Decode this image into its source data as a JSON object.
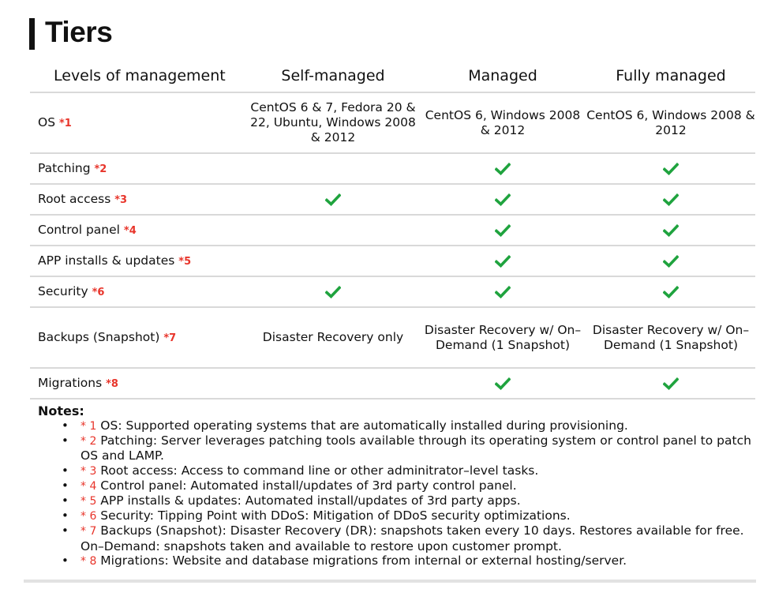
{
  "page": {
    "title": "Tiers"
  },
  "colors": {
    "accent_red": "#e8352b",
    "check_green": "#1fa33e",
    "divider": "#d9d9d9"
  },
  "table": {
    "headers": [
      "Levels of management",
      "Self-managed",
      "Managed",
      "Fully managed"
    ],
    "rows": [
      {
        "feature": "OS",
        "ref": "*1",
        "height": "tall",
        "cells": [
          {
            "type": "text",
            "value": "CentOS 6 & 7, Fedora 20 & 22, Ubuntu, Windows 2008 & 2012"
          },
          {
            "type": "text",
            "value": "CentOS 6, Windows 2008 & 2012"
          },
          {
            "type": "text",
            "value": "CentOS 6, Windows 2008 & 2012"
          }
        ]
      },
      {
        "feature": "Patching",
        "ref": "*2",
        "height": "short",
        "cells": [
          {
            "type": "empty",
            "value": ""
          },
          {
            "type": "check",
            "value": "check-icon"
          },
          {
            "type": "check",
            "value": "check-icon"
          }
        ]
      },
      {
        "feature": "Root access",
        "ref": "*3",
        "height": "short",
        "cells": [
          {
            "type": "check",
            "value": "check-icon"
          },
          {
            "type": "check",
            "value": "check-icon"
          },
          {
            "type": "check",
            "value": "check-icon"
          }
        ]
      },
      {
        "feature": "Control panel",
        "ref": "*4",
        "height": "short",
        "cells": [
          {
            "type": "empty",
            "value": ""
          },
          {
            "type": "check",
            "value": "check-icon"
          },
          {
            "type": "check",
            "value": "check-icon"
          }
        ]
      },
      {
        "feature": "APP installs & updates",
        "ref": "*5",
        "height": "short",
        "cells": [
          {
            "type": "empty",
            "value": ""
          },
          {
            "type": "check",
            "value": "check-icon"
          },
          {
            "type": "check",
            "value": "check-icon"
          }
        ]
      },
      {
        "feature": "Security",
        "ref": "*6",
        "height": "short",
        "cells": [
          {
            "type": "check",
            "value": "check-icon"
          },
          {
            "type": "check",
            "value": "check-icon"
          },
          {
            "type": "check",
            "value": "check-icon"
          }
        ]
      },
      {
        "feature": "Backups (Snapshot)",
        "ref": "*7",
        "height": "tall",
        "cells": [
          {
            "type": "text",
            "value": "Disaster Recovery only"
          },
          {
            "type": "text",
            "value": "Disaster Recovery w/ On–Demand (1 Snapshot)"
          },
          {
            "type": "text",
            "value": "Disaster Recovery w/ On–Demand (1 Snapshot)"
          }
        ]
      },
      {
        "feature": "Migrations",
        "ref": "*8",
        "height": "short",
        "cells": [
          {
            "type": "empty",
            "value": ""
          },
          {
            "type": "check",
            "value": "check-icon"
          },
          {
            "type": "check",
            "value": "check-icon"
          }
        ]
      }
    ]
  },
  "notes": {
    "title": "Notes:",
    "items": [
      {
        "ref": "* 1",
        "text": " OS: Supported operating systems that are automatically installed during provisioning."
      },
      {
        "ref": "* 2",
        "text": " Patching: Server leverages patching tools available through its operating system or control panel to patch OS and LAMP."
      },
      {
        "ref": "* 3",
        "text": " Root access: Access to command line or other adminitrator–level tasks."
      },
      {
        "ref": "* 4",
        "text": " Control panel: Automated install/updates of 3rd party control panel."
      },
      {
        "ref": "* 5",
        "text": " APP installs & updates: Automated install/updates of 3rd party apps."
      },
      {
        "ref": "* 6",
        "text": " Security: Tipping Point with DDoS: Mitigation of DDoS security optimizations."
      },
      {
        "ref": "* 7",
        "text": " Backups (Snapshot): Disaster Recovery (DR): snapshots taken every 10 days. Restores available for free. On–Demand: snapshots taken and available to restore upon customer prompt."
      },
      {
        "ref": "* 8",
        "text": " Migrations: Website and database migrations from internal or external hosting/server."
      }
    ]
  }
}
